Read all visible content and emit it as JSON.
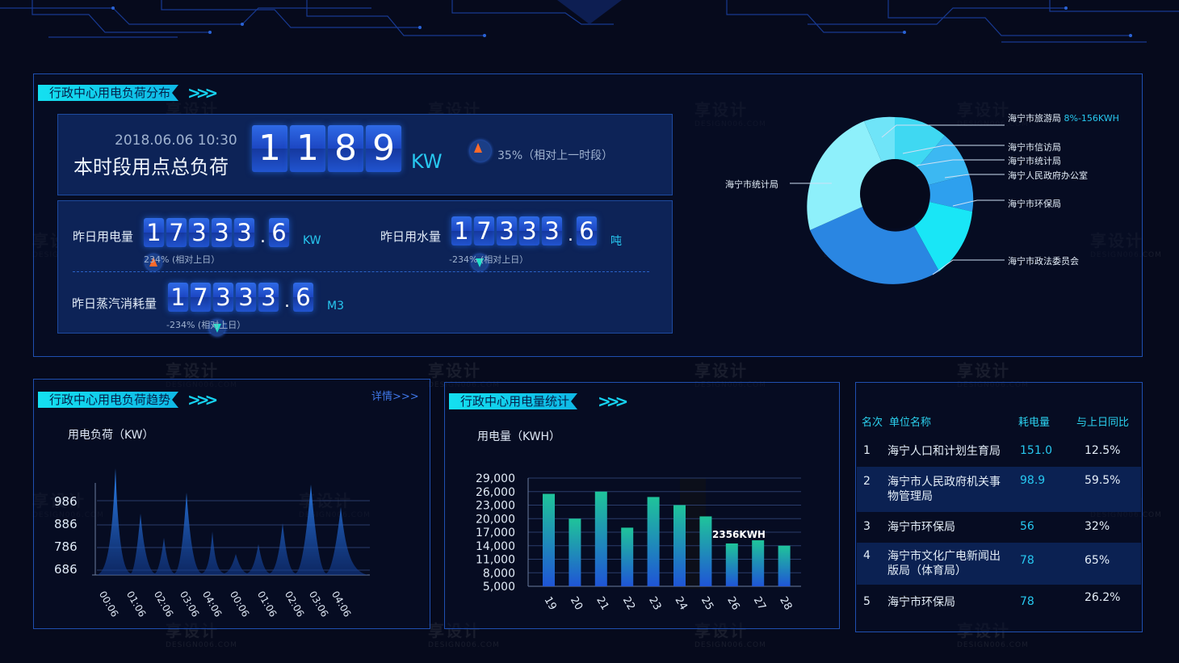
{
  "load_panel": {
    "title": "行政中心用电负荷分布",
    "datetime": "2018.06.06 10:30",
    "label": "本时段用点总负荷",
    "digits": [
      "1",
      "1",
      "8",
      "9"
    ],
    "unit": "KW",
    "change": "35%（相对上一时段）"
  },
  "electricity": {
    "label": "昨日用电量",
    "digits": [
      "1",
      "7",
      "3",
      "3",
      "3"
    ],
    "decimal": "6",
    "unit": "KW",
    "change": "234% (相对上日）"
  },
  "water": {
    "label": "昨日用水量",
    "digits": [
      "1",
      "7",
      "3",
      "3",
      "3"
    ],
    "decimal": "6",
    "unit": "吨",
    "change": "-234% (相对上日）"
  },
  "steam": {
    "label": "昨日蒸汽消耗量",
    "digits": [
      "1",
      "7",
      "3",
      "3",
      "3"
    ],
    "decimal": "6",
    "unit": "M3",
    "change": "-234% (相对上日）"
  },
  "pie": {
    "left_label": "海宁市统计局",
    "right_labels": [
      {
        "name": "海宁市旅游局",
        "extra": "8%-156KWH"
      },
      {
        "name": "海宁市信访局",
        "extra": ""
      },
      {
        "name": "海宁市统计局",
        "extra": ""
      },
      {
        "name": "海宁人民政府办公室",
        "extra": ""
      },
      {
        "name": "海宁市环保局",
        "extra": ""
      },
      {
        "name": "海宁市政法委员会",
        "extra": ""
      }
    ],
    "colors": {
      "light": "#9ef4fb",
      "cyan": "#1ce3f3",
      "blue": "#2e9ff0",
      "deep": "#1d6fd6"
    }
  },
  "trend": {
    "title": "行政中心用电负荷趋势",
    "details": "详情>>>",
    "unit_label": "用电负荷（KW）",
    "y_ticks": [
      "986",
      "886",
      "786",
      "686"
    ],
    "x_ticks": [
      "00:06",
      "01:06",
      "02:06",
      "03:06",
      "04:06",
      "00:06",
      "01:06",
      "02:06",
      "03:06",
      "04:06"
    ]
  },
  "chart_data": {
    "type": "bar",
    "title": "行政中心用电量统计",
    "ylabel": "用电量（KWH）",
    "categories": [
      "19",
      "20",
      "21",
      "22",
      "23",
      "24",
      "25",
      "26",
      "27",
      "28"
    ],
    "values": [
      25500,
      20000,
      26000,
      18000,
      24800,
      23000,
      20500,
      14500,
      15200,
      14000
    ],
    "y_ticks": [
      "29,000",
      "26,000",
      "23,000",
      "20,000",
      "17,000",
      "14,000",
      "11,000",
      "8,000",
      "5,000"
    ],
    "ylim": [
      5000,
      29000
    ],
    "annotation": "2356KWH",
    "colors": {
      "top": "#1fc49a",
      "bottom": "#1f55d6"
    }
  },
  "ranking": {
    "headers": {
      "rank": "名次",
      "name": "单位名称",
      "usage": "耗电量",
      "ratio": "与上日同比"
    },
    "rows": [
      {
        "rank": "1",
        "name": "海宁人口和计划生育局",
        "usage": "151.0",
        "ratio": "12.5%"
      },
      {
        "rank": "2",
        "name": "海宁市人民政府机关事物管理局",
        "usage": "98.9",
        "ratio": "59.5%"
      },
      {
        "rank": "3",
        "name": "海宁市环保局",
        "usage": "56",
        "ratio": "32%"
      },
      {
        "rank": "4",
        "name": "海宁市文化广电新闻出版局（体育局）",
        "usage": "78",
        "ratio": "65%"
      },
      {
        "rank": "5",
        "name": "海宁市环保局",
        "usage": "78",
        "ratio": "26.2%"
      }
    ]
  }
}
